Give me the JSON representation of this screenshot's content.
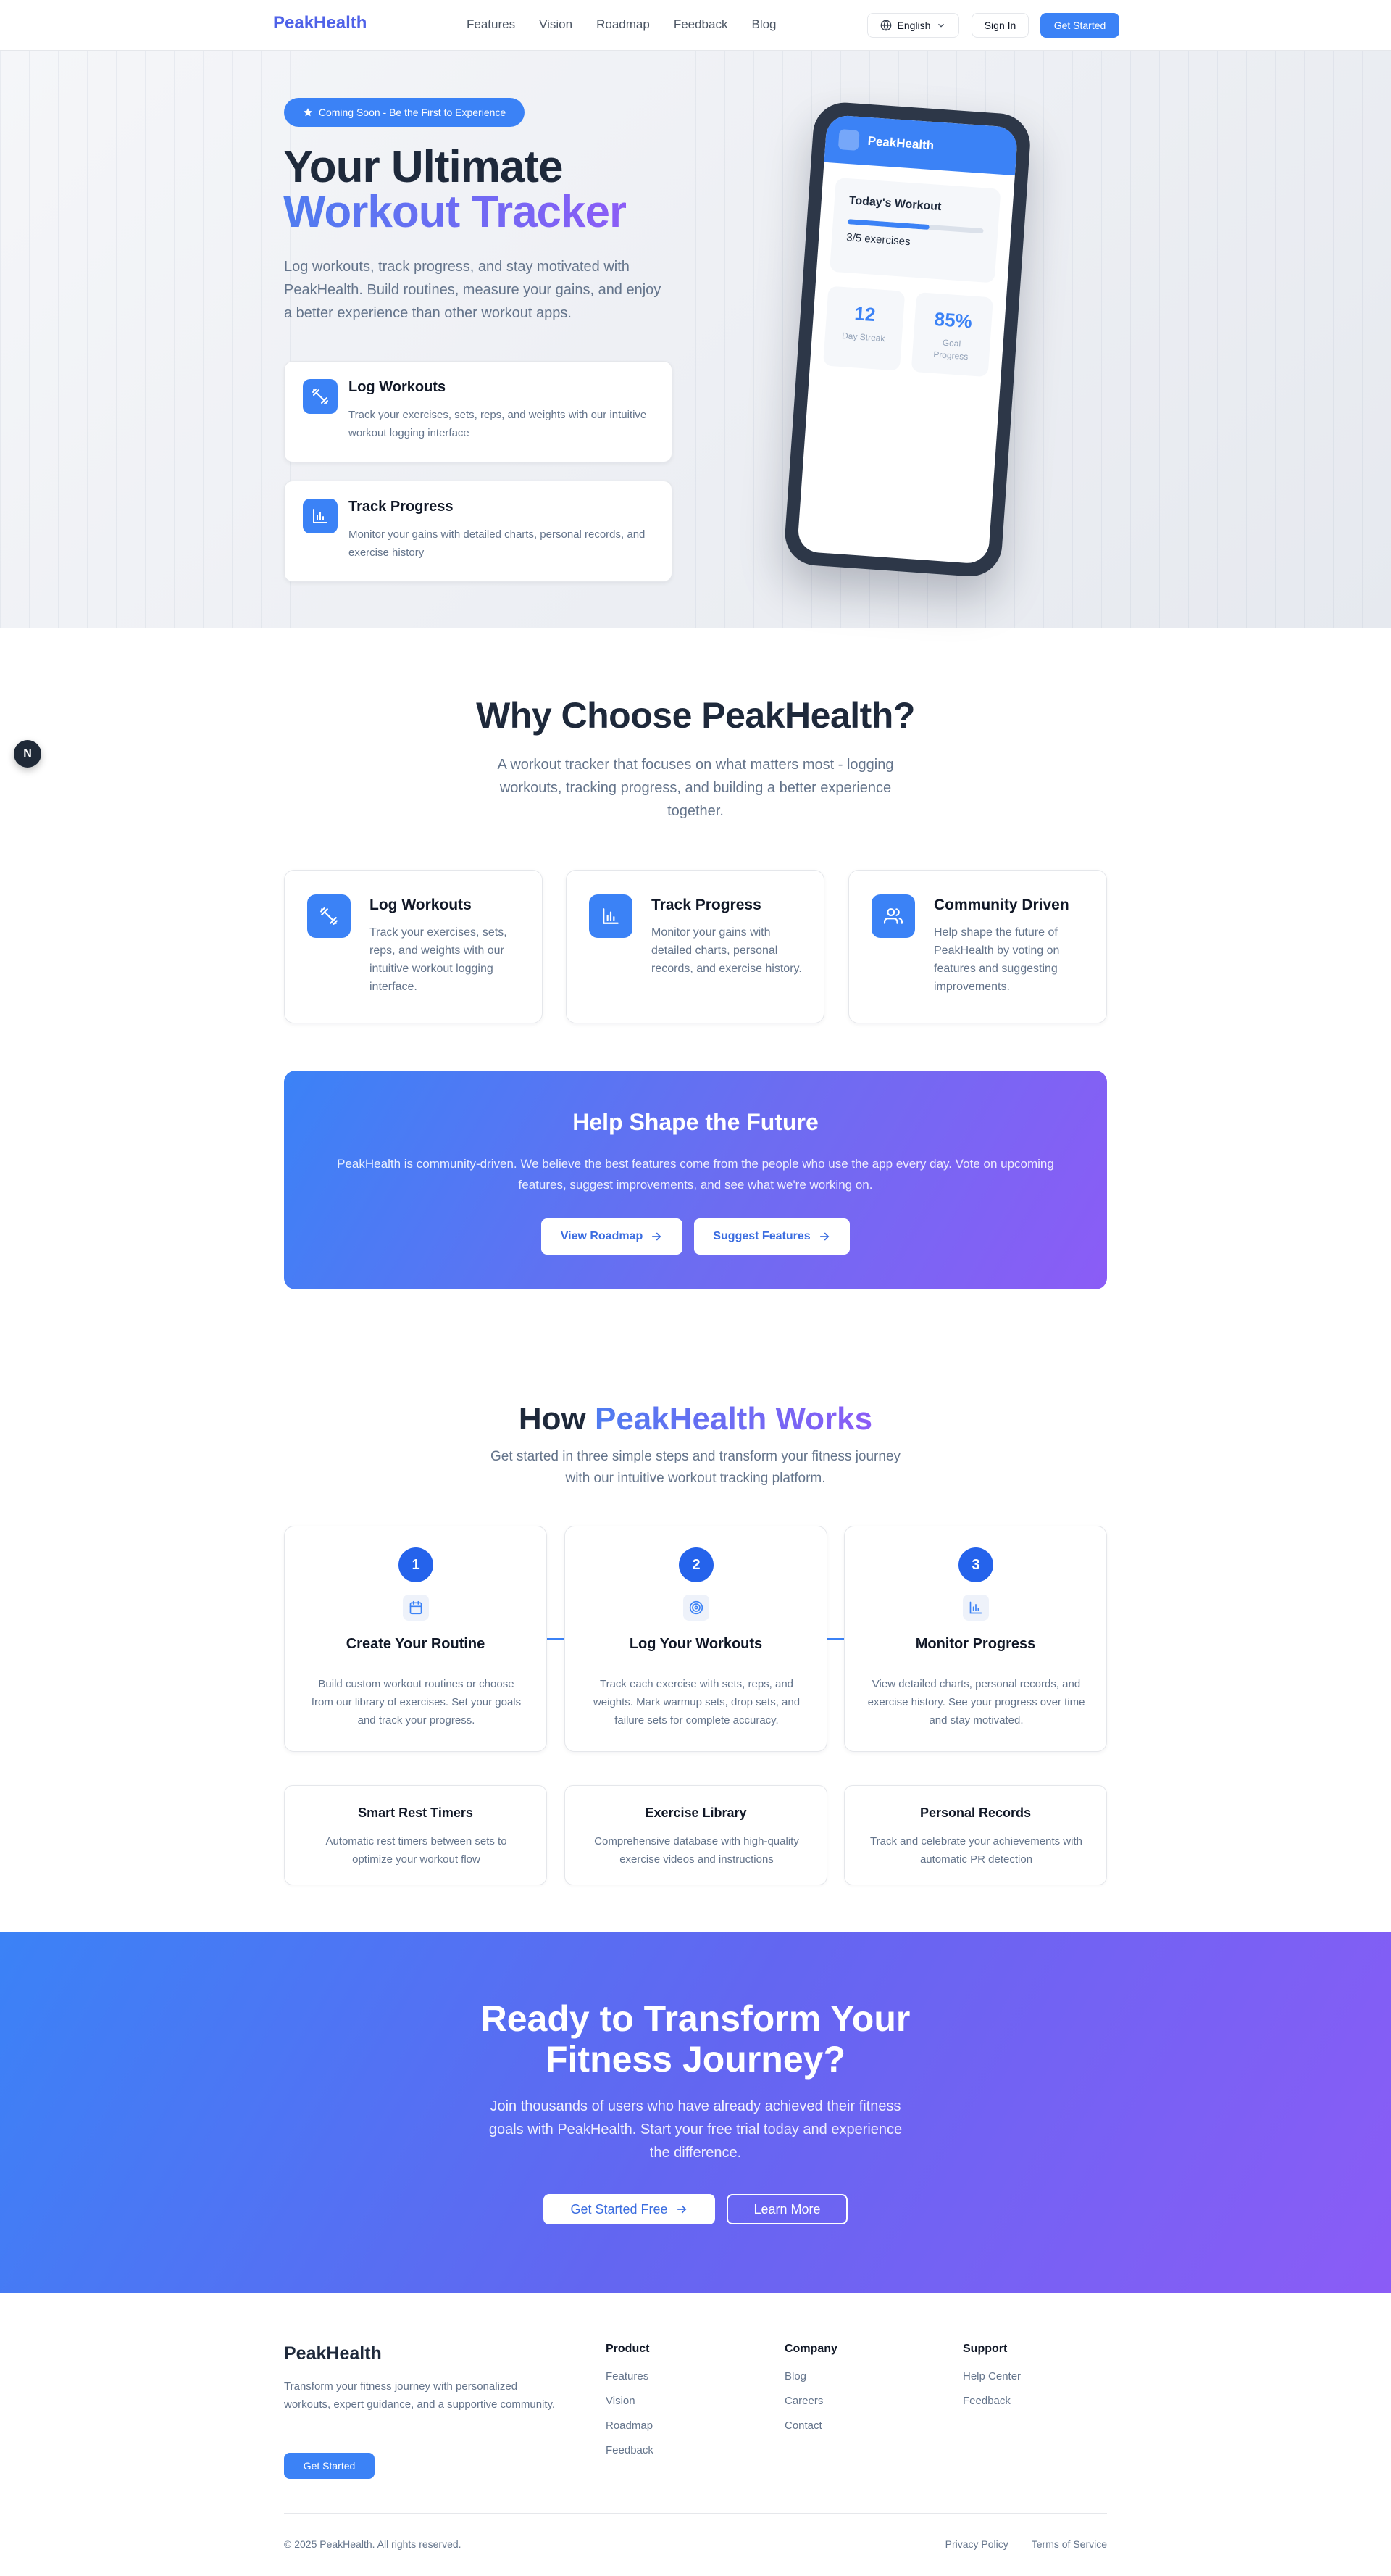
{
  "nav": {
    "logo": "PeakHealth",
    "links": [
      "Features",
      "Vision",
      "Roadmap",
      "Feedback",
      "Blog"
    ],
    "language": "English",
    "sign_in": "Sign In",
    "get_started": "Get Started"
  },
  "hero": {
    "badge": "Coming Soon - Be the First to Experience",
    "title_line1": "Your Ultimate",
    "title_line2": "Workout Tracker",
    "description": "Log workouts, track progress, and stay motivated with PeakHealth. Build routines, measure your gains, and enjoy a better experience than other workout apps.",
    "cards": [
      {
        "icon": "dumbbell-icon",
        "title": "Log Workouts",
        "desc": "Track your exercises, sets, reps, and weights with our intuitive workout logging interface"
      },
      {
        "icon": "bar-chart-icon",
        "title": "Track Progress",
        "desc": "Monitor your gains with detailed charts, personal records, and exercise history"
      }
    ],
    "phone": {
      "app_name": "PeakHealth",
      "workout_title": "Today's Workout",
      "workout_progress": 0.6,
      "workout_count": "3/5 exercises",
      "stats": [
        {
          "value": "12",
          "label": "Day Streak"
        },
        {
          "value": "85%",
          "label": "Goal Progress"
        }
      ]
    }
  },
  "floating_badge": "N",
  "why": {
    "title": "Why Choose PeakHealth?",
    "description": "A workout tracker that focuses on what matters most - logging workouts, tracking progress, and building a better experience together.",
    "cards": [
      {
        "icon": "dumbbell-icon",
        "title": "Log Workouts",
        "desc": "Track your exercises, sets, reps, and weights with our intuitive workout logging interface."
      },
      {
        "icon": "bar-chart-icon",
        "title": "Track Progress",
        "desc": "Monitor your gains with detailed charts, personal records, and exercise history."
      },
      {
        "icon": "users-icon",
        "title": "Community Driven",
        "desc": "Help shape the future of PeakHealth by voting on features and suggesting improvements."
      }
    ],
    "cta": {
      "title": "Help Shape the Future",
      "desc": "PeakHealth is community-driven. We believe the best features come from the people who use the app every day. Vote on upcoming features, suggest improvements, and see what we're working on.",
      "btn_roadmap": "View Roadmap",
      "btn_suggest": "Suggest Features"
    }
  },
  "how": {
    "title_plain": "How",
    "title_grad": "PeakHealth Works",
    "description": "Get started in three simple steps and transform your fitness journey with our intuitive workout tracking platform.",
    "steps": [
      {
        "num": "1",
        "icon": "calendar-icon",
        "title": "Create Your Routine",
        "desc": "Build custom workout routines or choose from our library of exercises. Set your goals and track your progress."
      },
      {
        "num": "2",
        "icon": "target-icon",
        "title": "Log Your Workouts",
        "desc": "Track each exercise with sets, reps, and weights. Mark warmup sets, drop sets, and failure sets for complete accuracy."
      },
      {
        "num": "3",
        "icon": "bar-chart-icon",
        "title": "Monitor Progress",
        "desc": "View detailed charts, personal records, and exercise history. See your progress over time and stay motivated."
      }
    ],
    "features": [
      {
        "title": "Smart Rest Timers",
        "desc": "Automatic rest timers between sets to optimize your workout flow"
      },
      {
        "title": "Exercise Library",
        "desc": "Comprehensive database with high-quality exercise videos and instructions"
      },
      {
        "title": "Personal Records",
        "desc": "Track and celebrate your achievements with automatic PR detection"
      }
    ]
  },
  "big_cta": {
    "title_line1": "Ready to Transform Your",
    "title_line2": "Fitness Journey?",
    "desc": "Join thousands of users who have already achieved their fitness goals with PeakHealth. Start your free trial today and experience the difference.",
    "btn_primary": "Get Started Free",
    "btn_secondary": "Learn More"
  },
  "footer": {
    "brand": "PeakHealth",
    "desc": "Transform your fitness journey with personalized workouts, expert guidance, and a supportive community.",
    "btn": "Get Started",
    "columns": [
      {
        "heading": "Product",
        "links": [
          "Features",
          "Vision",
          "Roadmap",
          "Feedback"
        ]
      },
      {
        "heading": "Company",
        "links": [
          "Blog",
          "Careers",
          "Contact"
        ]
      },
      {
        "heading": "Support",
        "links": [
          "Help Center",
          "Feedback"
        ]
      }
    ],
    "copyright": "© 2025 PeakHealth. All rights reserved.",
    "legal": [
      "Privacy Policy",
      "Terms of Service"
    ]
  },
  "colors": {
    "primary": "#3b82f6",
    "accent_purple": "#8b5cf6",
    "text_dark": "#1e293b",
    "text_muted": "#64748b"
  }
}
